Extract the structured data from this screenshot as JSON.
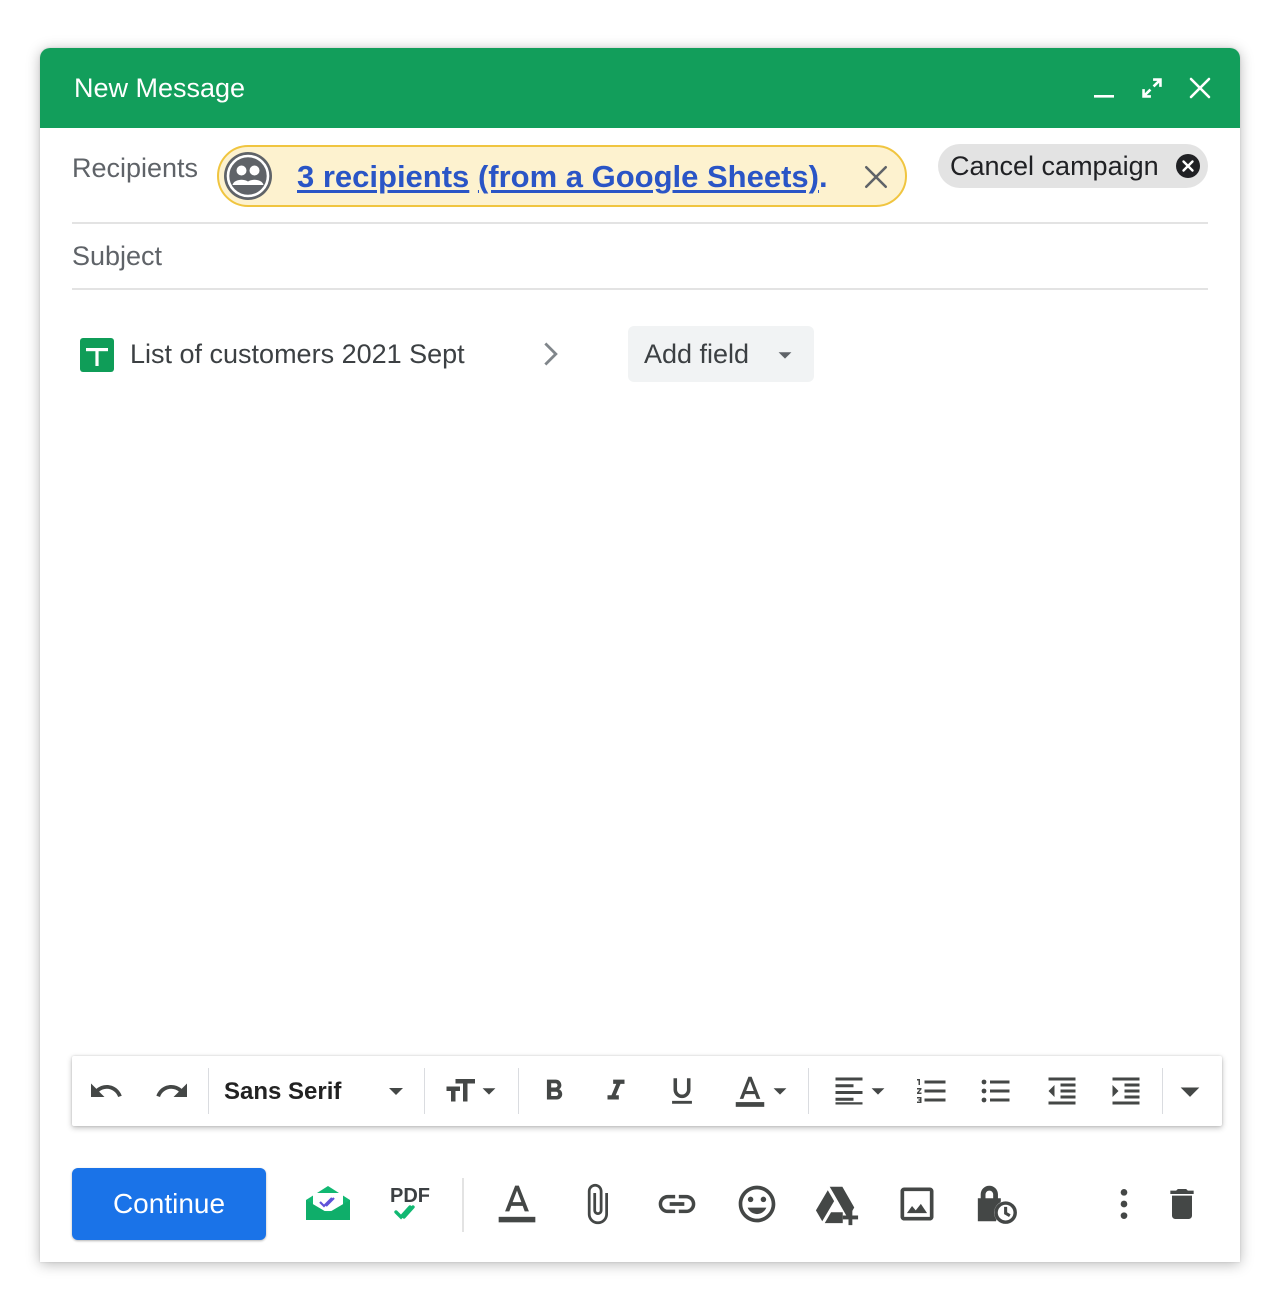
{
  "window": {
    "title": "New Message",
    "accent_color": "#129e5b"
  },
  "title_controls": {
    "minimize_icon": "minimize-icon",
    "expand_icon": "expand-icon",
    "close_icon": "close-icon"
  },
  "recipients": {
    "label": "Recipients",
    "chip_count_text": "3 recipients",
    "chip_source_text": "(from a Google Sheets)",
    "chip_trailing": ".",
    "chip_icon": "group-icon",
    "chip_colors": {
      "background": "#fdf2cf",
      "border": "#f0c540",
      "link": "#2a55c6"
    },
    "cancel_label": "Cancel campaign"
  },
  "subject": {
    "label": "Subject",
    "value": ""
  },
  "sheet": {
    "name": "List of customers 2021 Sept",
    "icon": "google-sheets-icon",
    "add_field_label": "Add field"
  },
  "format_toolbar": {
    "font_family": "Sans Serif",
    "tools": [
      "undo",
      "redo",
      "font-size",
      "bold",
      "italic",
      "underline",
      "text-color",
      "align",
      "numbered-list",
      "bulleted-list",
      "indent-less",
      "indent-more",
      "more-formatting"
    ]
  },
  "bottom_bar": {
    "continue_label": "Continue",
    "primary_color": "#1a73e8",
    "pdf_label": "PDF",
    "tools": [
      "mailmeteor-tracking",
      "pdf-tracking",
      "formatting-options",
      "attach-files",
      "insert-link",
      "insert-emoji",
      "insert-drive",
      "insert-photo",
      "confidential-mode",
      "more-options",
      "discard-draft"
    ]
  }
}
